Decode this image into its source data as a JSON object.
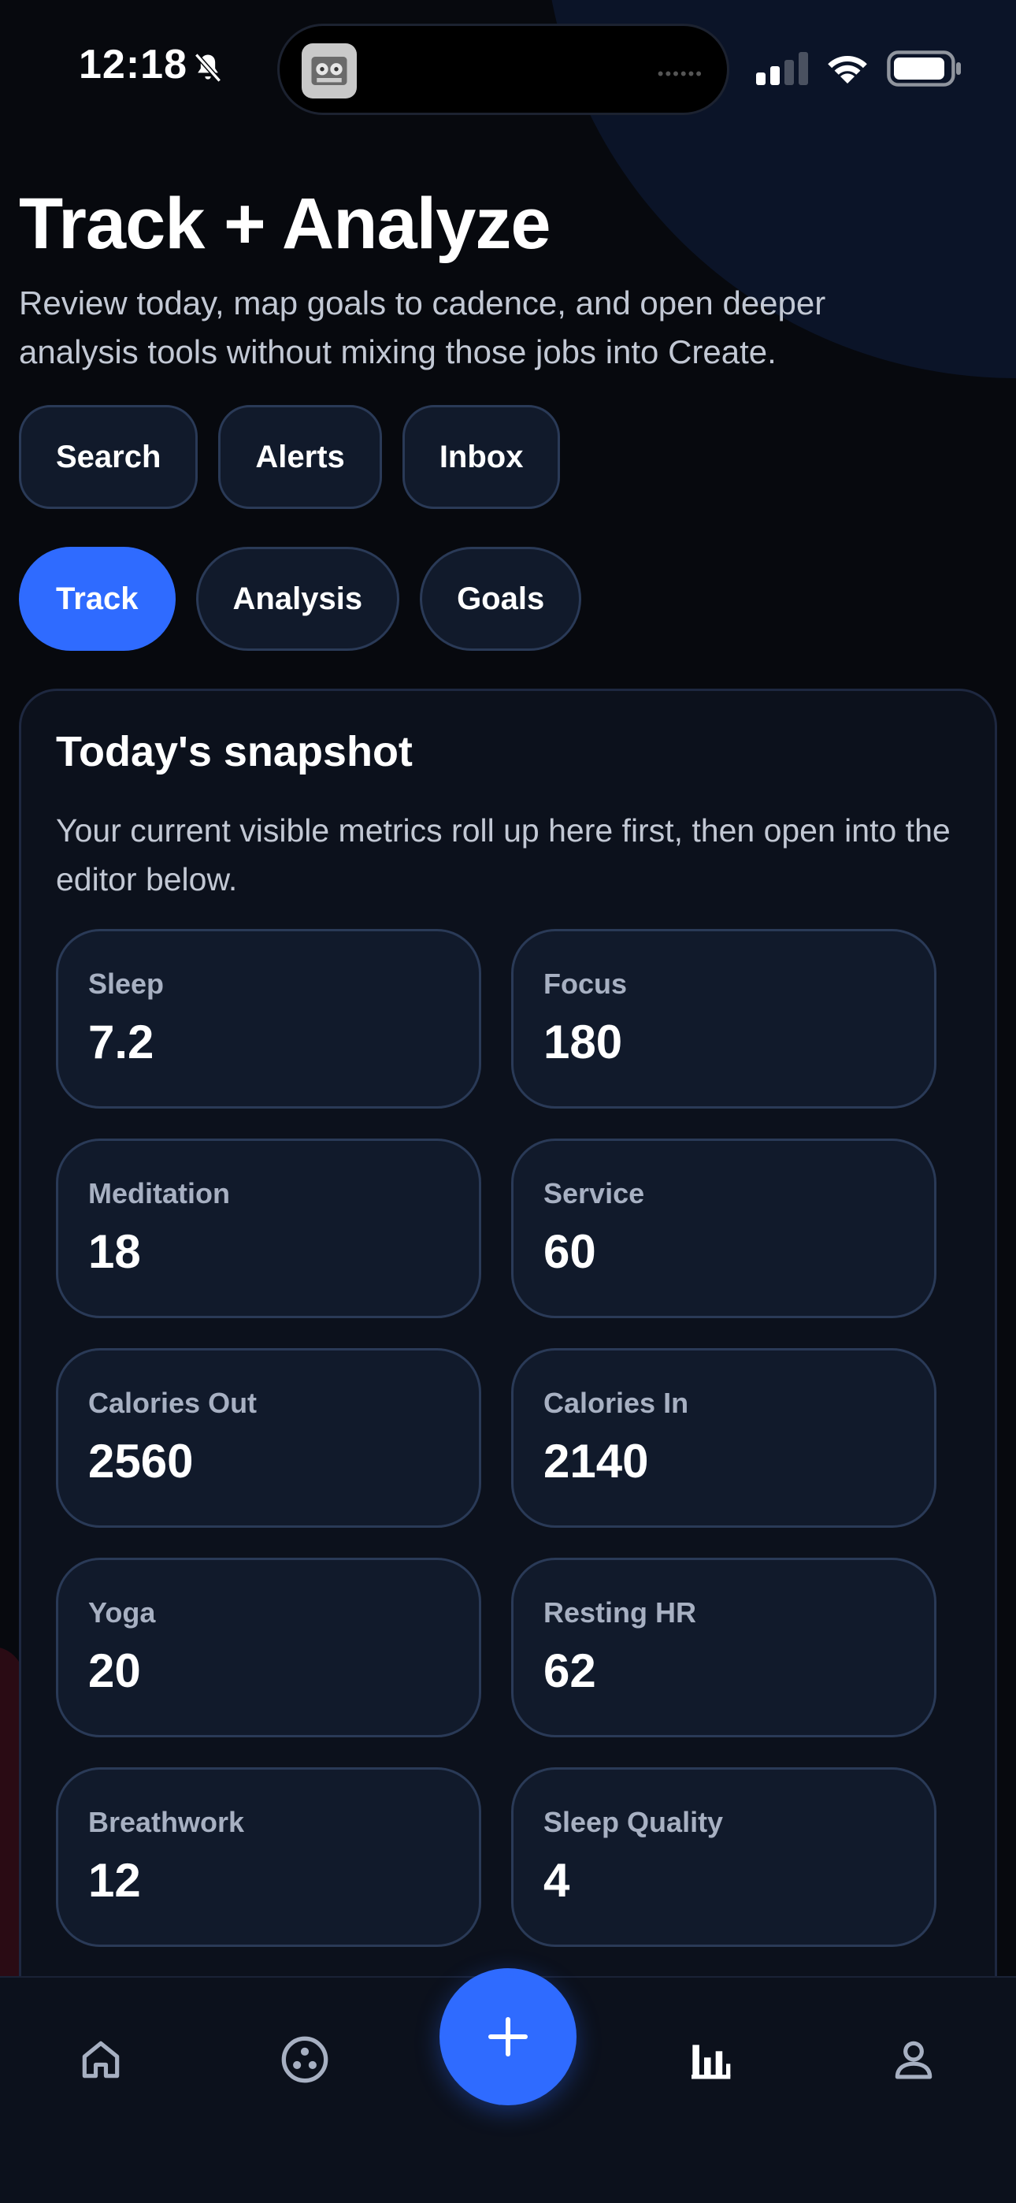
{
  "status_bar": {
    "time": "12:18"
  },
  "header": {
    "title": "Track + Analyze",
    "subtitle": "Review today, map goals to cadence, and open deeper analysis tools without mixing those jobs into Create."
  },
  "actions": [
    {
      "label": "Search"
    },
    {
      "label": "Alerts"
    },
    {
      "label": "Inbox"
    }
  ],
  "tabs": [
    {
      "label": "Track",
      "active": true
    },
    {
      "label": "Analysis",
      "active": false
    },
    {
      "label": "Goals",
      "active": false
    }
  ],
  "snapshot": {
    "title": "Today's snapshot",
    "description": "Your current visible metrics roll up here first, then open into the editor below.",
    "metrics": [
      {
        "label": "Sleep",
        "value": "7.2"
      },
      {
        "label": "Focus",
        "value": "180"
      },
      {
        "label": "Meditation",
        "value": "18"
      },
      {
        "label": "Service",
        "value": "60"
      },
      {
        "label": "Calories Out",
        "value": "2560"
      },
      {
        "label": "Calories In",
        "value": "2140"
      },
      {
        "label": "Yoga",
        "value": "20"
      },
      {
        "label": "Resting HR",
        "value": "62"
      },
      {
        "label": "Breathwork",
        "value": "12"
      },
      {
        "label": "Sleep Quality",
        "value": "4"
      }
    ]
  },
  "bottom_nav": {
    "items": [
      "home-icon",
      "community-icon",
      "add-icon",
      "chart-icon",
      "profile-icon"
    ],
    "active": "chart-icon"
  },
  "colors": {
    "background": "#07090e",
    "accent": "#2f6bff",
    "card": "#111a2b",
    "border": "#2a3a57"
  }
}
